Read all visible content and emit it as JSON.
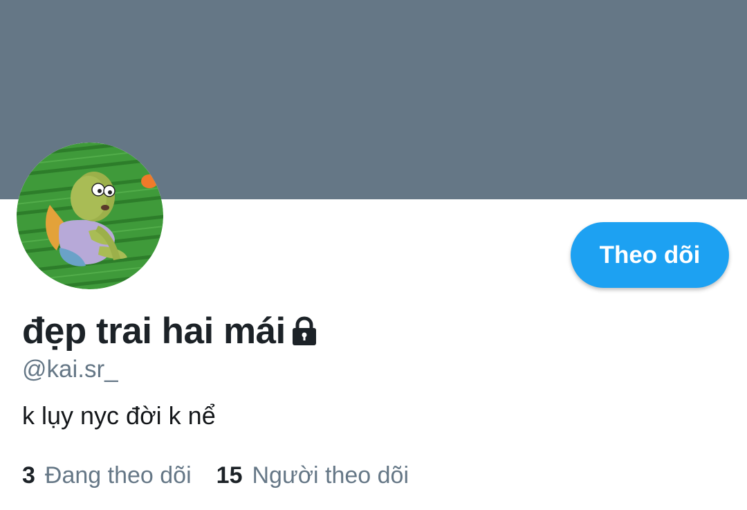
{
  "profile": {
    "display_name": "đẹp trai hai mái",
    "handle": "@kai.sr_",
    "bio": "k lụy nyc đời k nể",
    "protected_icon": "lock-icon",
    "avatar_icon": "cartoon-fish-avatar"
  },
  "actions": {
    "follow_label": "Theo dõi"
  },
  "stats": {
    "following_count": "3",
    "following_label": "Đang theo dõi",
    "followers_count": "15",
    "followers_label": "Người theo dõi"
  },
  "colors": {
    "banner": "#657786",
    "accent": "#1da1f2",
    "text_primary": "#14171a",
    "text_secondary": "#657786"
  }
}
